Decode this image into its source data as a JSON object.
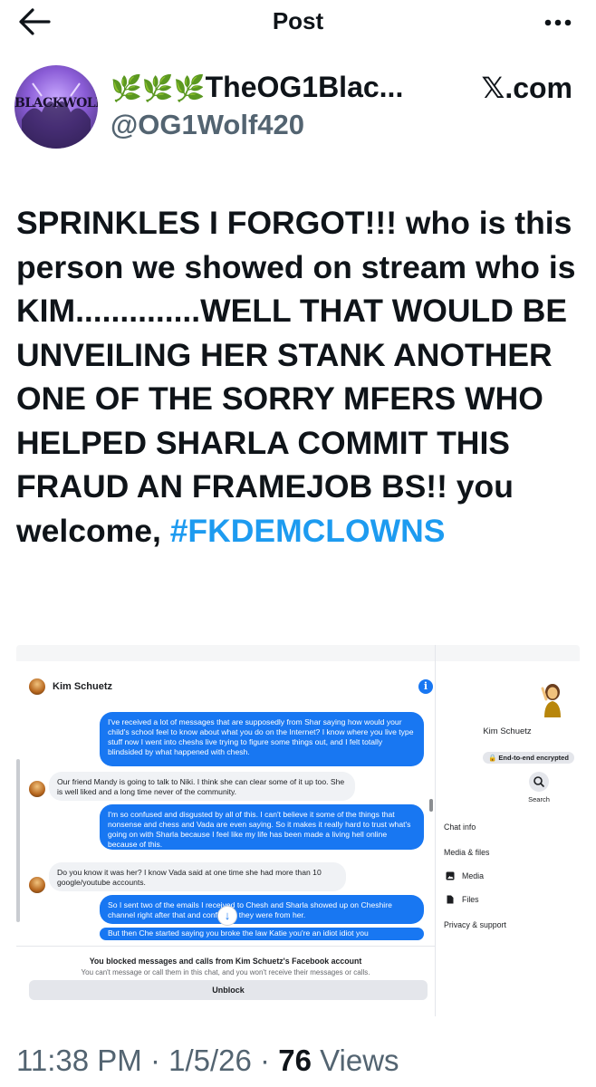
{
  "header": {
    "title": "Post"
  },
  "author": {
    "avatar_text": "BLACKWOLF",
    "display_name_emoji": "🌿🌿🌿",
    "display_name": "TheOG1Blac...",
    "handle": "@OG1Wolf420",
    "source": "𝕏.com"
  },
  "post": {
    "text": "SPRINKLES I FORGOT!!! who is this person we showed on stream who is KIM..............WELL THAT WOULD BE UNVEILING HER STANK ANOTHER ONE OF THE SORRY MFERS WHO HELPED SHARLA COMMIT THIS FRAUD AN FRAMEJOB BS!! you welcome, ",
    "hashtag": "#FKDEMCLOWNS"
  },
  "embed": {
    "contact_name": "Kim Schuetz",
    "messages": [
      {
        "side": "out",
        "text": "I've received a lot of messages that are supposedly from Shar saying how would your child's school feel to know about what you do on the Internet? I know where you live type stuff now I went into cheshs live trying to figure some things out, and I felt totally blindsided by what happened with chesh."
      },
      {
        "side": "in",
        "text": "Our friend Mandy is going to talk to Niki. I think she can clear some of it up too. She is well liked and a long time never of the community."
      },
      {
        "side": "out",
        "text": "I'm so confused and disgusted by all of this. I can't believe it some of the things that nonsense and chess and Vada are even saying. So it makes it really hard to trust what's going on with Sharla because I feel like my life has been made a living hell online because of this."
      },
      {
        "side": "in",
        "text": "Do you know it was her? I know Vada said at one time she had more than 10 google/youtube accounts."
      },
      {
        "side": "out",
        "text": "So I sent two of the emails I received to Chesh and Sharla showed up on Cheshire channel right after that and confirmed they were from her."
      },
      {
        "side": "out",
        "text": "But then Che started saying you broke the law Katie you're an idiot idiot you"
      }
    ],
    "blocked_title": "You blocked messages and calls from Kim Schuetz's Facebook account",
    "blocked_sub": "You can't message or call them in this chat, and you won't receive their messages or calls.",
    "unblock_label": "Unblock",
    "side_name": "Kim Schuetz",
    "e2e_label": "🔒 End-to-end encrypted",
    "search_label": "Search",
    "side_items": {
      "chat_info": "Chat info",
      "media_files": "Media & files",
      "media": "Media",
      "files": "Files",
      "privacy": "Privacy & support"
    }
  },
  "meta": {
    "time": "11:38 PM",
    "date": "1/5/26",
    "views_count": "76",
    "views_label": "Views",
    "sep": " · "
  },
  "colors": {
    "link": "#1d9bf0",
    "messenger_blue": "#1877f2",
    "muted": "#536471"
  }
}
